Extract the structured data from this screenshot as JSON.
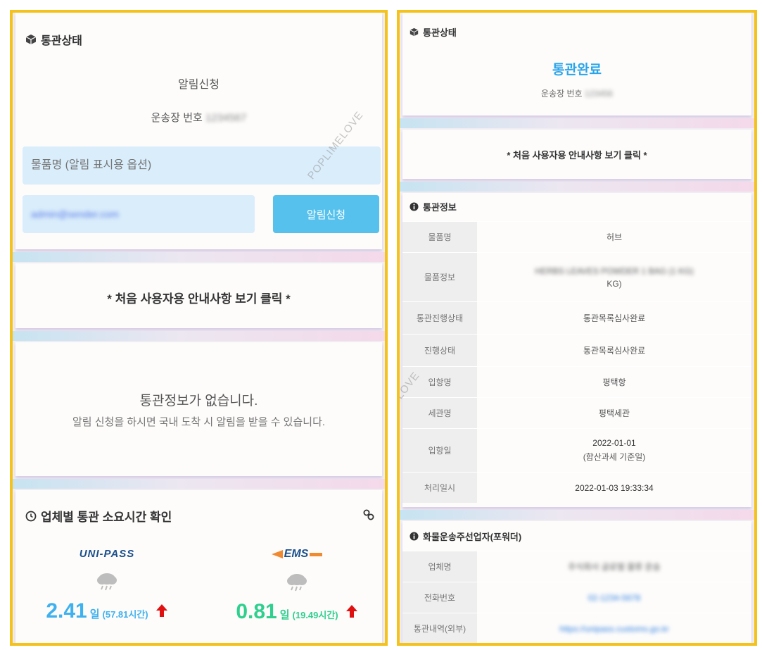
{
  "left": {
    "status_title": "통관상태",
    "notify_heading": "알림신청",
    "waybill_label": "운송장 번호",
    "waybill_value": "1234567",
    "item_input_placeholder": "물품명 (알림 표시용 옵션)",
    "email_value": "admin@sender.com",
    "notify_button": "알림신청",
    "guide_text": "* 처음 사용자용 안내사항 보기 클릭 *",
    "empty_title": "통관정보가 없습니다.",
    "empty_subtitle": "알림 신청을 하시면 국내 도착 시 알림을 받을 수 있습니다.",
    "carrier_section_title": "업체별 통관 소요시간 확인",
    "carriers": [
      {
        "logo": "UNI-PASS",
        "days": "2.41",
        "day_unit": "일",
        "hours": "(57.81시간)",
        "color": "#3eb1ee",
        "trend": "up"
      },
      {
        "logo": "EMS",
        "days": "0.81",
        "day_unit": "일",
        "hours": "(19.49시간)",
        "color": "#2fcf8e",
        "trend": "up"
      }
    ]
  },
  "right": {
    "status_title": "통관상태",
    "status_value": "통관완료",
    "waybill_label": "운송장 번호",
    "waybill_value": "123456",
    "guide_text": "* 처음 사용자용 안내사항 보기 클릭 *",
    "info_title": "통관정보",
    "info_rows": [
      {
        "label": "물품명",
        "value": "허브",
        "sub": ""
      },
      {
        "label": "물품정보",
        "value": "HERBS LEAVES POWDER 1 BAG (1 KG)",
        "sub": "KG)"
      },
      {
        "label": "통관진행상태",
        "value": "통관목록심사완료",
        "sub": ""
      },
      {
        "label": "진행상태",
        "value": "통관목록심사완료",
        "sub": ""
      },
      {
        "label": "입항명",
        "value": "평택항",
        "sub": ""
      },
      {
        "label": "세관명",
        "value": "평택세관",
        "sub": ""
      },
      {
        "label": "입항일",
        "value": "2022-01-01",
        "sub": "(합산과세 기준일)"
      },
      {
        "label": "처리일시",
        "value": "2022-01-03 19:33:34",
        "sub": ""
      }
    ],
    "forwarder_title": "화물운송주선업자(포워더)",
    "forwarder_rows": [
      {
        "label": "업체명",
        "value": "주식회사 글로벌 물류 운송"
      },
      {
        "label": "전화번호",
        "value": "02-1234-5678"
      },
      {
        "label": "통관내역(외부)",
        "value": "https://unipass.customs.go.kr"
      }
    ]
  },
  "watermark": "POPLIMELOVE",
  "colors": {
    "border": "#f4c21b",
    "accent_blue": "#2aa5ea",
    "button": "#55c1ec",
    "input_bg": "#d9edfb",
    "up_arrow": "#e01010"
  }
}
